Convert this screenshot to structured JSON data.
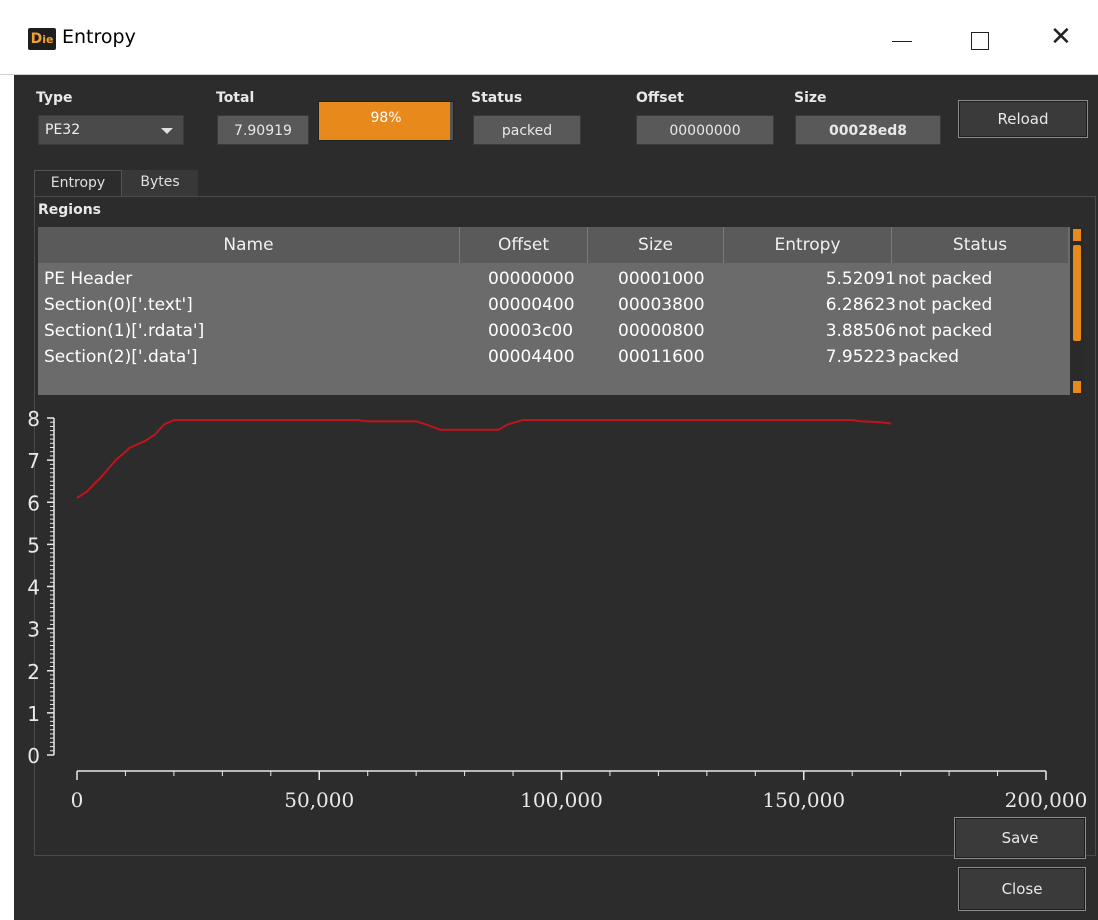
{
  "window": {
    "title": "Entropy",
    "app_icon": "die-logo-icon",
    "controls": [
      "minimize-icon",
      "maximize-icon",
      "close-icon"
    ]
  },
  "header": {
    "type_label": "Type",
    "type_value": "PE32",
    "total_label": "Total",
    "total_value": "7.90919",
    "progress_text": "98%",
    "progress_value": 0.98,
    "status_label": "Status",
    "status_value": "packed",
    "offset_label": "Offset",
    "offset_value": "00000000",
    "size_label": "Size",
    "size_value": "00028ed8",
    "reload_label": "Reload"
  },
  "tabs": [
    {
      "label": "Entropy",
      "active": true
    },
    {
      "label": "Bytes",
      "active": false
    }
  ],
  "regions": {
    "label": "Regions",
    "columns": [
      "Name",
      "Offset",
      "Size",
      "Entropy",
      "Status"
    ],
    "rows": [
      {
        "name": "PE Header",
        "offset": "00000000",
        "size": "00001000",
        "entropy": "5.52091",
        "status": "not packed"
      },
      {
        "name": "Section(0)['.text']",
        "offset": "00000400",
        "size": "00003800",
        "entropy": "6.28623",
        "status": "not packed"
      },
      {
        "name": "Section(1)['.rdata']",
        "offset": "00003c00",
        "size": "00000800",
        "entropy": "3.88506",
        "status": "not packed"
      },
      {
        "name": "Section(2)['.data']",
        "offset": "00004400",
        "size": "00011600",
        "entropy": "7.95223",
        "status": "packed"
      }
    ]
  },
  "chart_data": {
    "type": "line",
    "x_ticks": [
      0,
      50000,
      100000,
      150000,
      200000
    ],
    "x_tick_labels": [
      "0",
      "50,000",
      "100,000",
      "150,000",
      "200,000"
    ],
    "y_ticks": [
      0,
      1,
      2,
      3,
      4,
      5,
      6,
      7,
      8
    ],
    "xlim": [
      0,
      200000
    ],
    "ylim": [
      0,
      8
    ],
    "series": [
      {
        "color": "#c0141c",
        "points": [
          [
            0,
            6.1
          ],
          [
            2000,
            6.25
          ],
          [
            5000,
            6.6
          ],
          [
            8000,
            7.0
          ],
          [
            11000,
            7.3
          ],
          [
            14000,
            7.45
          ],
          [
            16000,
            7.6
          ],
          [
            18000,
            7.85
          ],
          [
            20000,
            7.95
          ],
          [
            30000,
            7.95
          ],
          [
            40000,
            7.95
          ],
          [
            50000,
            7.95
          ],
          [
            58000,
            7.95
          ],
          [
            60000,
            7.92
          ],
          [
            70000,
            7.92
          ],
          [
            72000,
            7.85
          ],
          [
            75000,
            7.72
          ],
          [
            80000,
            7.72
          ],
          [
            87000,
            7.72
          ],
          [
            89000,
            7.85
          ],
          [
            92000,
            7.95
          ],
          [
            100000,
            7.95
          ],
          [
            110000,
            7.95
          ],
          [
            120000,
            7.95
          ],
          [
            130000,
            7.95
          ],
          [
            140000,
            7.95
          ],
          [
            150000,
            7.95
          ],
          [
            160000,
            7.95
          ],
          [
            162000,
            7.92
          ],
          [
            166000,
            7.9
          ],
          [
            168000,
            7.87
          ]
        ]
      }
    ]
  },
  "buttons": {
    "save_label": "Save",
    "close_label": "Close"
  }
}
